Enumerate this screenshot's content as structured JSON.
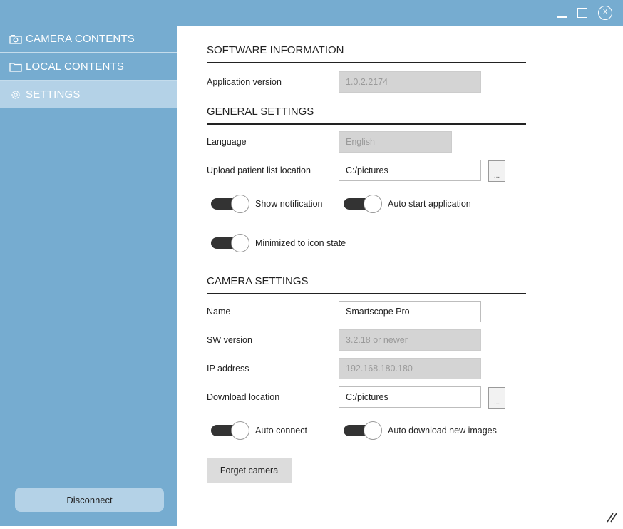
{
  "window": {
    "controls": {
      "minimize_icon": "minimize-icon",
      "maximize_icon": "maximize-icon",
      "close_label": "X"
    }
  },
  "sidebar": {
    "items": [
      {
        "label": "CAMERA CONTENTS",
        "icon": "camera-icon"
      },
      {
        "label": "LOCAL CONTENTS",
        "icon": "folder-icon"
      },
      {
        "label": "SETTINGS",
        "icon": "gear-icon",
        "selected": true
      }
    ],
    "disconnect_label": "Disconnect"
  },
  "software_information": {
    "title": "SOFTWARE INFORMATION",
    "application_version_label": "Application version",
    "application_version_value": "1.0.2.2174"
  },
  "general_settings": {
    "title": "GENERAL SETTINGS",
    "language_label": "Language",
    "language_value": "English",
    "upload_location_label": "Upload patient list location",
    "upload_location_value": "C:/pictures",
    "browse_label": "...",
    "show_notification_label": "Show notification",
    "auto_start_label": "Auto start application",
    "minimized_label": "Minimized to icon state"
  },
  "camera_settings": {
    "title": "CAMERA SETTINGS",
    "name_label": "Name",
    "name_value": "Smartscope Pro",
    "sw_version_label": "SW version",
    "sw_version_value": "3.2.18 or newer",
    "ip_label": "IP address",
    "ip_value": "192.168.180.180",
    "download_location_label": "Download location",
    "download_location_value": "C:/pictures",
    "browse_label": "...",
    "auto_connect_label": "Auto connect",
    "auto_download_label": "Auto download new images",
    "forget_label": "Forget camera"
  },
  "colors": {
    "sidebar": "#76acd0",
    "selected": "#b4d2e7",
    "toggle_rail": "#333333"
  }
}
